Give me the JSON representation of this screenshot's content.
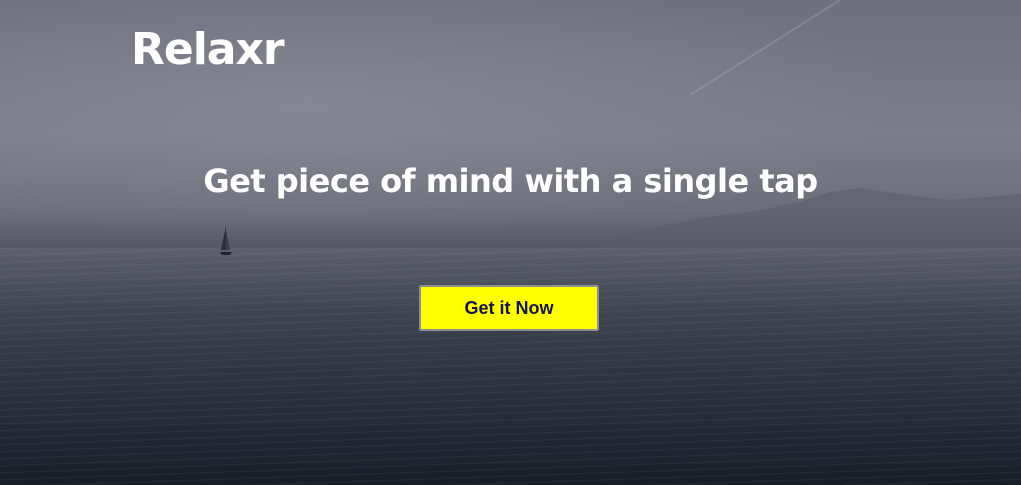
{
  "brand": {
    "name": "Relaxr"
  },
  "hero": {
    "tagline": "Get piece of mind with a single tap",
    "cta_label": "Get it Now",
    "background_image": "misty-sea-with-sailboat"
  },
  "colors": {
    "cta_background": "#ffff00",
    "cta_text": "#141452",
    "text": "#ffffff"
  }
}
